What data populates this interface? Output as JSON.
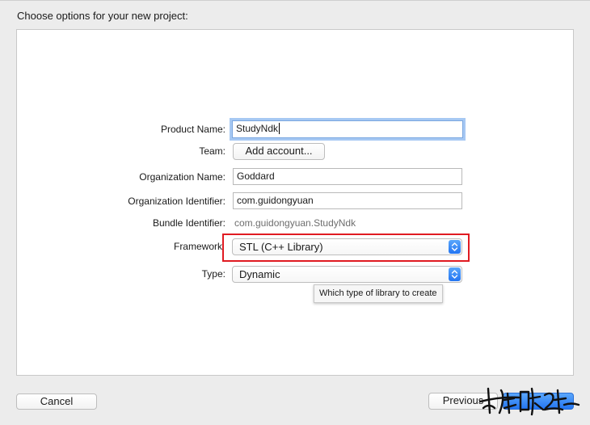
{
  "dialog": {
    "heading": "Choose options for your new project:"
  },
  "form": {
    "product_name": {
      "label": "Product Name:",
      "value": "StudyNdk"
    },
    "team": {
      "label": "Team:",
      "button": "Add account..."
    },
    "organization_name": {
      "label": "Organization Name:",
      "value": "Goddard"
    },
    "organization_identifier": {
      "label": "Organization Identifier:",
      "value": "com.guidongyuan"
    },
    "bundle_identifier": {
      "label": "Bundle Identifier:",
      "value": "com.guidongyuan.StudyNdk"
    },
    "framework": {
      "label": "Framework",
      "selected": "STL (C++ Library)"
    },
    "type": {
      "label": "Type:",
      "selected": "Dynamic"
    }
  },
  "tooltip": {
    "text": "Which type of library to create"
  },
  "footer": {
    "cancel": "Cancel",
    "previous": "Previous"
  },
  "icons": {
    "popup_stepper": "chevron-up-down-icon"
  },
  "colors": {
    "accent": "#2375f2",
    "focus_ring": "#a6c8f3",
    "annotation_red": "#e01b22"
  }
}
